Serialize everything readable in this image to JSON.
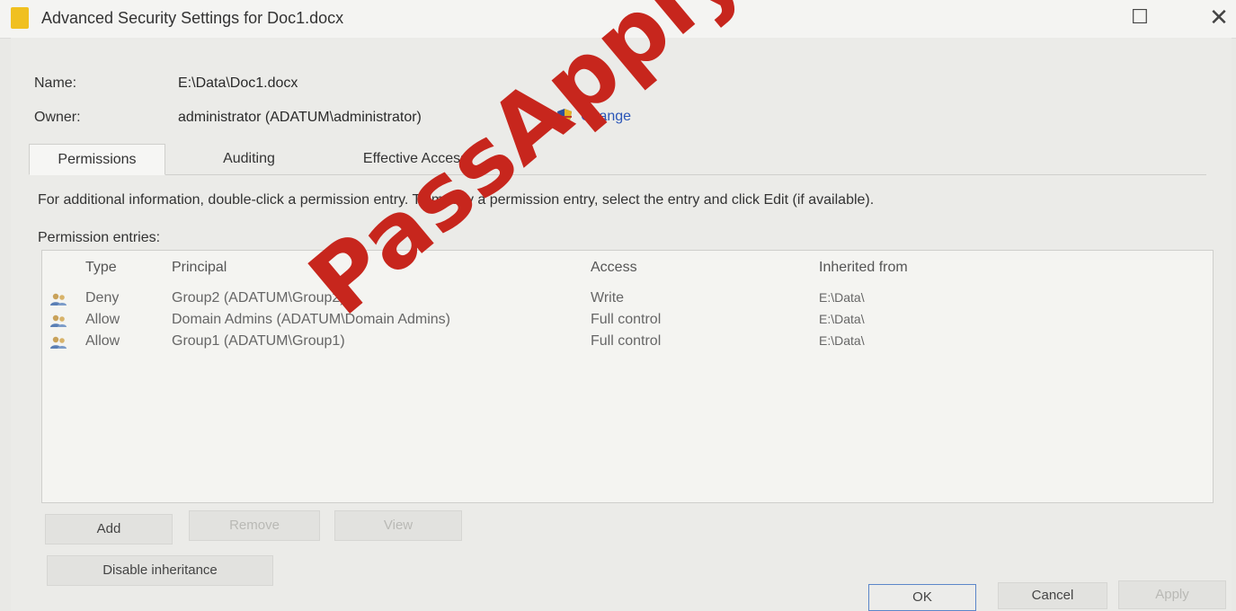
{
  "window": {
    "title": "Advanced Security Settings for Doc1.docx",
    "maximize_icon": "☐",
    "close_icon": "✕"
  },
  "fields": {
    "name_label": "Name:",
    "name_value": "E:\\Data\\Doc1.docx",
    "owner_label": "Owner:",
    "owner_value": "administrator (ADATUM\\administrator)",
    "change_link": "Change"
  },
  "tabs": [
    {
      "label": "Permissions",
      "active": true
    },
    {
      "label": "Auditing",
      "active": false
    },
    {
      "label": "Effective Access",
      "active": false
    }
  ],
  "info_text": "For additional information, double-click a permission entry. To modify a permission entry, select the entry and click Edit (if available).",
  "entries_label": "Permission entries:",
  "columns": [
    "Type",
    "Principal",
    "Access",
    "Inherited from"
  ],
  "entries": [
    {
      "type": "Deny",
      "principal": "Group2 (ADATUM\\Group2)",
      "access": "Write",
      "inherited": "E:\\Data\\"
    },
    {
      "type": "Allow",
      "principal": "Domain Admins (ADATUM\\Domain Admins)",
      "access": "Full control",
      "inherited": "E:\\Data\\"
    },
    {
      "type": "Allow",
      "principal": "Group1 (ADATUM\\Group1)",
      "access": "Full control",
      "inherited": "E:\\Data\\"
    }
  ],
  "buttons": {
    "add": "Add",
    "remove": "Remove",
    "view": "View",
    "disable_inheritance": "Disable inheritance",
    "ok": "OK",
    "cancel": "Cancel",
    "apply": "Apply"
  },
  "watermark": "PassApply.com",
  "colors": {
    "link": "#2b56b8",
    "watermark": "#c7261d",
    "ok_border": "#5b86c9"
  }
}
